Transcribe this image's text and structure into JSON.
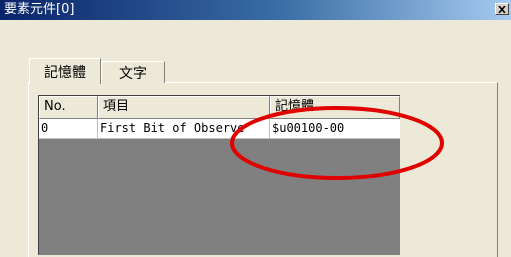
{
  "window": {
    "title": "要素元件[0]",
    "close_icon": "close-icon"
  },
  "tabs": [
    {
      "label": "記憶體",
      "active": true
    },
    {
      "label": "文字",
      "active": false
    }
  ],
  "table": {
    "columns": [
      "No.",
      "項目",
      "記憶體"
    ],
    "rows": [
      {
        "no": "0",
        "item": "First Bit of Observe",
        "memory": "$u00100-00"
      }
    ]
  },
  "annotation": {
    "shape": "ellipse",
    "color": "#e00000"
  },
  "colors": {
    "window_bg": "#ece9d8",
    "title_start": "#0a246a",
    "title_end": "#a6caf0",
    "grid_empty": "#808080"
  }
}
